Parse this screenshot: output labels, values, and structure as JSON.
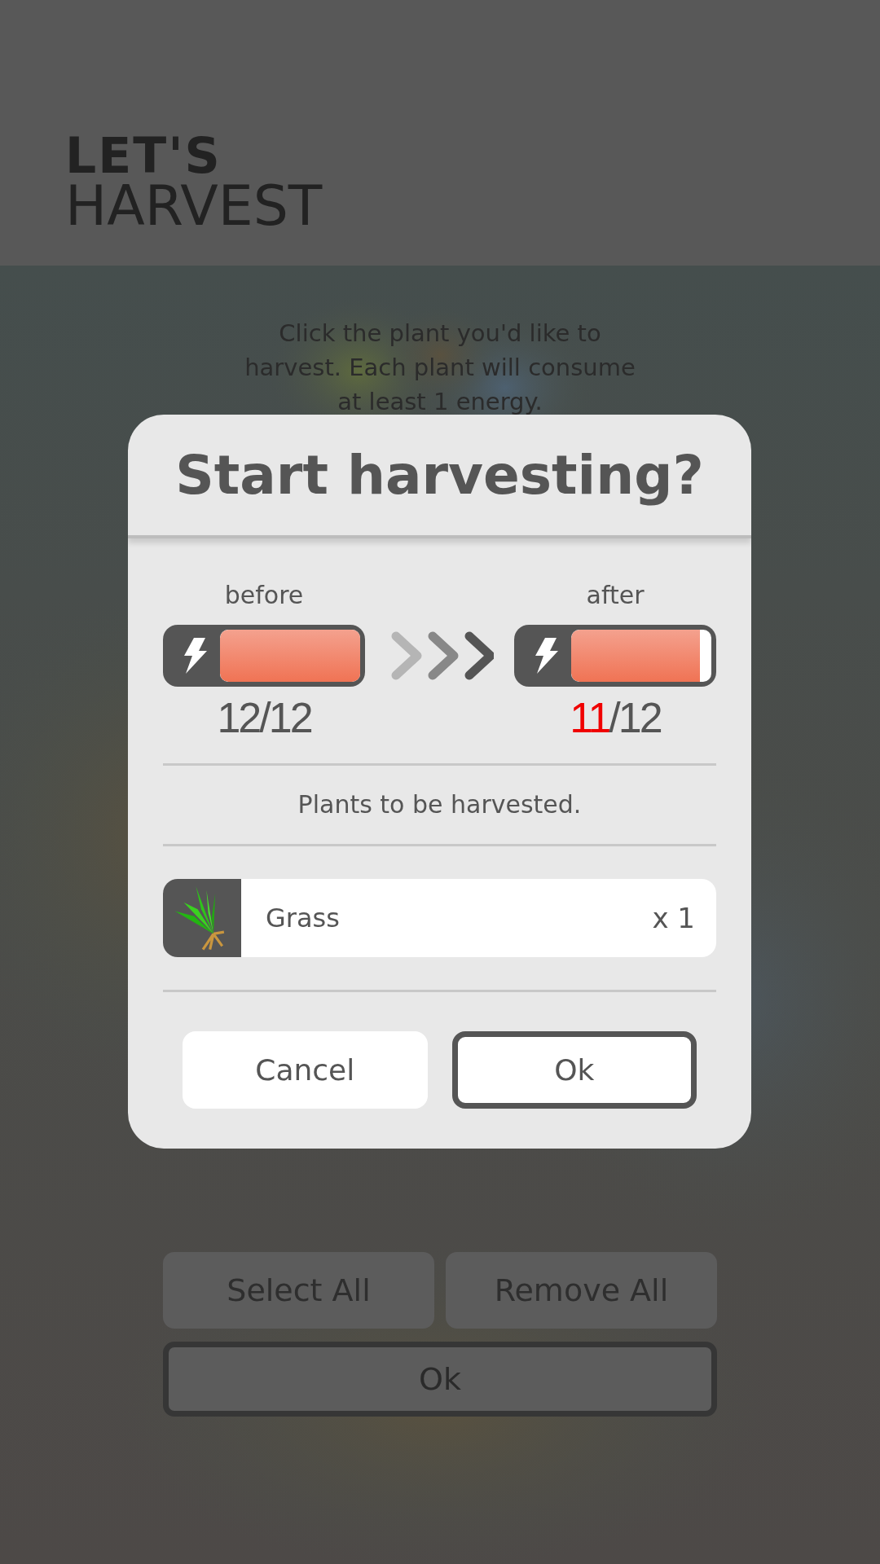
{
  "header": {
    "title_line_1": "LET'S",
    "title_line_2": "HARVEST"
  },
  "instructions": "Click the plant you'd like to harvest. Each plant will consume at least 1 energy.",
  "background_buttons": [
    {
      "label": "Select All",
      "kind": "plain"
    },
    {
      "label": "Remove All",
      "kind": "plain"
    },
    {
      "label": "Ok",
      "kind": "outlined"
    }
  ],
  "dialog": {
    "title": "Start harvesting?",
    "energy": [
      {
        "label": "before",
        "level": 1,
        "count": "12",
        "total": "/12",
        "changed": false
      },
      {
        "label": "after",
        "level": 0.917,
        "count": "11",
        "total": "/12",
        "changed": true
      }
    ],
    "list_heading": "Plants to be harvested.",
    "plants": [
      {
        "name": "Grass",
        "quantity": "x 1"
      }
    ],
    "buttons": [
      {
        "label": "Cancel",
        "kind": "plain"
      },
      {
        "label": "Ok",
        "kind": "outlined"
      }
    ]
  }
}
